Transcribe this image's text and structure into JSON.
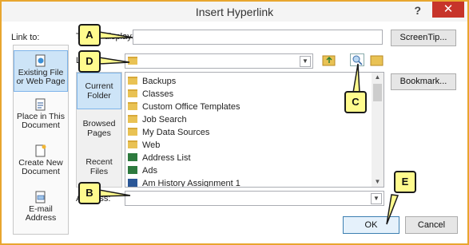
{
  "dialog": {
    "title": "Insert Hyperlink",
    "help": "?",
    "close": "✕"
  },
  "link_to": {
    "label": "Link to:",
    "items": [
      {
        "label": "Existing File or Web Page",
        "icon": "globe-file-icon",
        "selected": true
      },
      {
        "label": "Place in This Document",
        "icon": "place-document-icon"
      },
      {
        "label": "Create New Document",
        "icon": "new-document-icon"
      },
      {
        "label": "E-mail Address",
        "icon": "email-icon"
      }
    ]
  },
  "text_to_display": {
    "label": "Text to display:",
    "value": ""
  },
  "look_in": {
    "label": "Look in:",
    "value": ""
  },
  "look_in_panel": [
    {
      "label": "Current Folder",
      "selected": true
    },
    {
      "label": "Browsed Pages"
    },
    {
      "label": "Recent Files"
    }
  ],
  "files": [
    {
      "name": "Backups",
      "type": "folder"
    },
    {
      "name": "Classes",
      "type": "folder"
    },
    {
      "name": "Custom Office Templates",
      "type": "folder"
    },
    {
      "name": "Job Search",
      "type": "folder"
    },
    {
      "name": "My Data Sources",
      "type": "datasource"
    },
    {
      "name": "Web",
      "type": "folder"
    },
    {
      "name": "Address List",
      "type": "doc"
    },
    {
      "name": "Ads",
      "type": "excel"
    },
    {
      "name": "Am History Assignment 1",
      "type": "word"
    }
  ],
  "address": {
    "label": "Address:",
    "value": ""
  },
  "buttons": {
    "screentip": "ScreenTip...",
    "bookmark": "Bookmark...",
    "ok": "OK",
    "cancel": "Cancel"
  },
  "callouts": {
    "a": "A",
    "b": "B",
    "c": "C",
    "d": "D",
    "e": "E"
  },
  "colors": {
    "callout_fill": "#fffb8e",
    "close_red": "#c7342a",
    "selection": "#cde4f7",
    "border": "#e8a62f"
  }
}
